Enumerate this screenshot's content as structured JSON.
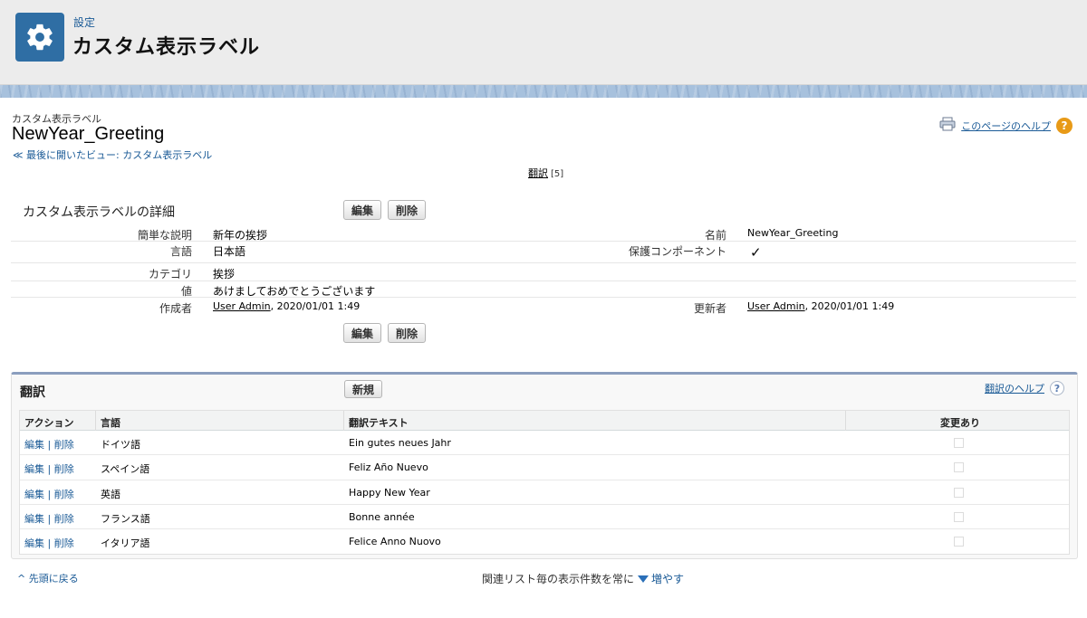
{
  "header": {
    "breadcrumb": "設定",
    "title": "カスタム表示ラベル"
  },
  "page": {
    "type_label": "カスタム表示ラベル",
    "record_title": "NewYear_Greeting",
    "back_link": "≪ 最後に開いたビュー: カスタム表示ラベル",
    "help_link": "このページのヘルプ",
    "translation_link": "翻訳",
    "translation_count": "[5]"
  },
  "detail": {
    "section_title": "カスタム表示ラベルの詳細",
    "edit_button": "編集",
    "delete_button": "削除",
    "fields": {
      "short_desc_label": "簡単な説明",
      "short_desc_value": "新年の挨拶",
      "name_label": "名前",
      "name_value": "NewYear_Greeting",
      "language_label": "言語",
      "language_value": "日本語",
      "protected_label": "保護コンポーネント",
      "protected_value": "✓",
      "category_label": "カテゴリ",
      "category_value": "挨拶",
      "value_label": "値",
      "value_value": "あけましておめでとうございます",
      "created_label": "作成者",
      "created_user": "User Admin",
      "created_date": ", 2020/01/01 1:49",
      "modified_label": "更新者",
      "modified_user": "User Admin",
      "modified_date": ", 2020/01/01 1:49"
    }
  },
  "translations": {
    "title": "翻訳",
    "new_button": "新規",
    "help_link": "翻訳のヘルプ",
    "columns": [
      "アクション",
      "言語",
      "翻訳テキスト",
      "変更あり"
    ],
    "rows": [
      {
        "edit": "編集",
        "sep": "|",
        "delete": "削除",
        "language": "ドイツ語",
        "text": "Ein gutes neues Jahr",
        "changed": false
      },
      {
        "edit": "編集",
        "sep": "|",
        "delete": "削除",
        "language": "スペイン語",
        "text": "Feliz Año Nuevo",
        "changed": false
      },
      {
        "edit": "編集",
        "sep": "|",
        "delete": "削除",
        "language": "英語",
        "text": "Happy New Year",
        "changed": false
      },
      {
        "edit": "編集",
        "sep": "|",
        "delete": "削除",
        "language": "フランス語",
        "text": "Bonne année",
        "changed": false
      },
      {
        "edit": "編集",
        "sep": "|",
        "delete": "削除",
        "language": "イタリア語",
        "text": "Felice Anno Nuovo",
        "changed": false
      }
    ]
  },
  "footer": {
    "back_to_top": "先頭に戻る",
    "show_more_text": "関連リスト毎の表示件数を常に",
    "show_more_link": "増やす"
  },
  "colors": {
    "accent": "#2f6ea4",
    "link": "#1a5a96",
    "help_icon": "#e89a17"
  }
}
